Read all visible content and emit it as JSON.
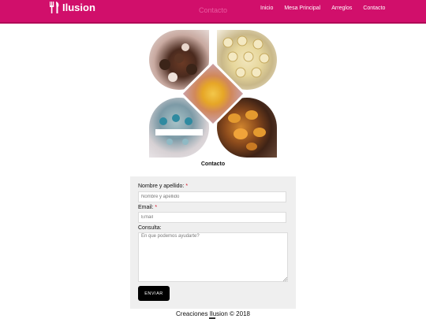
{
  "header": {
    "logo_text": "Ilusion",
    "logo_icon": "fork-knife-icon",
    "ghost_title": "Contacto",
    "background_color": "#d10f6b",
    "nav": [
      {
        "label": "Inicio"
      },
      {
        "label": "Mesa Principal"
      },
      {
        "label": "Arreglos"
      },
      {
        "label": "Contacto"
      }
    ]
  },
  "collage": {
    "caption": "Contacto"
  },
  "form": {
    "name_label": "Nombre y apellido:",
    "name_required": "*",
    "name_placeholder": "Nombre y apellido",
    "email_label": "Email:",
    "email_required": "*",
    "email_placeholder": "Email",
    "message_label": "Consulta:",
    "message_placeholder": "En que podemos ayudarte?",
    "submit_label": "ENVIAR"
  },
  "footer": {
    "copyright": "Creaciones Ilusion © 2018"
  }
}
